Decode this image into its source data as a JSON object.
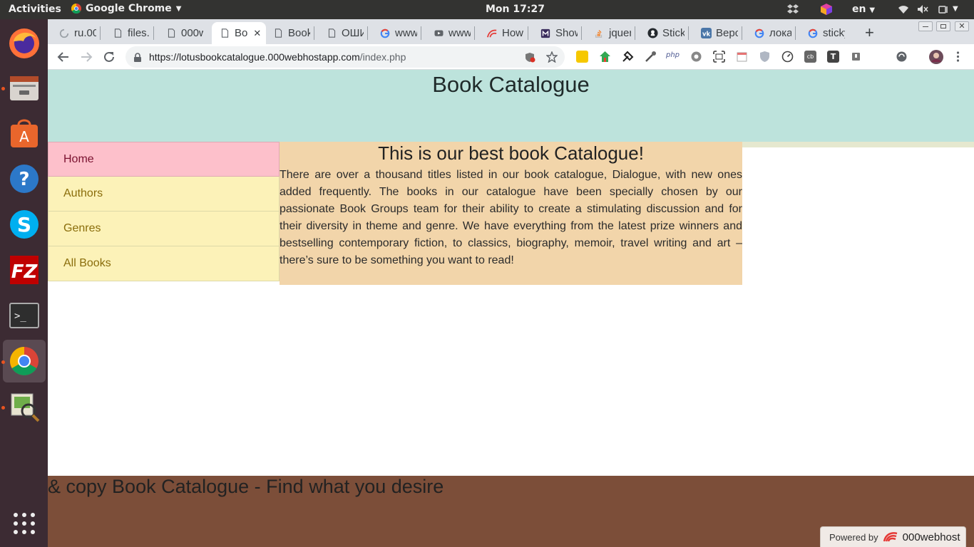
{
  "topbar": {
    "activities": "Activities",
    "app_name": "Google Chrome",
    "clock": "Mon 17:27",
    "lang": "en",
    "icons": [
      "dropbox-icon",
      "color-cube-icon",
      "wifi-icon",
      "volume-icon",
      "power-icon"
    ]
  },
  "dock": {
    "apps": [
      "firefox-icon",
      "files-icon",
      "software-center-icon",
      "help-icon",
      "skype-icon",
      "filezilla-icon",
      "terminal-icon",
      "chrome-icon",
      "image-viewer-icon",
      "app-grid-icon"
    ]
  },
  "tabs": [
    {
      "label": "ru.00",
      "icon": "loading-icon"
    },
    {
      "label": "files.",
      "icon": "doc-icon"
    },
    {
      "label": "000w",
      "icon": "doc-icon"
    },
    {
      "label": "Bo",
      "icon": "doc-icon",
      "active": true
    },
    {
      "label": "Book",
      "icon": "doc-icon"
    },
    {
      "label": "ОШИ",
      "icon": "doc-icon"
    },
    {
      "label": "www",
      "icon": "google-icon"
    },
    {
      "label": "www",
      "icon": "youtube-icon"
    },
    {
      "label": "How",
      "icon": "000webhost-icon"
    },
    {
      "label": "Show",
      "icon": "mamp-icon"
    },
    {
      "label": "jquer",
      "icon": "stackoverflow-icon"
    },
    {
      "label": "Stick",
      "icon": "github-icon"
    },
    {
      "label": "Верс",
      "icon": "vk-icon"
    },
    {
      "label": "лока",
      "icon": "google-icon"
    },
    {
      "label": "sticky",
      "icon": "google-icon"
    }
  ],
  "new_tab_label": "+",
  "address": {
    "host": "https://lotusbookcatalogue.000webhostapp.com",
    "path": "/index.php"
  },
  "page": {
    "title": "Book Catalogue",
    "nav": [
      "Home",
      "Authors",
      "Genres",
      "All Books"
    ],
    "heading": "This is our best book Catalogue!",
    "intro": "There are over a thousand titles listed in our book catalogue, Dialogue, with new ones added frequently. The books in our catalogue have been specially chosen by our passionate Book Groups team for their ability to create a stimulating discussion and for their diversity in theme and genre. We have everything from the latest prize winners and bestselling contemporary fiction, to classics, biography, memoir, travel writing and art – there’s sure to be something you want to read!",
    "footer": "& copy Book Catalogue - Find what you desire",
    "powered_by": "Powered by",
    "powered_brand": "000webhost"
  },
  "colors": {
    "header_bg": "#bde3dc",
    "nav_active": "#fdc0cb",
    "nav_bg": "#fcf2b8",
    "main_bg": "#f2d5aa",
    "footer_bg": "#7c4e39",
    "dock_bg": "#3c2b33"
  }
}
